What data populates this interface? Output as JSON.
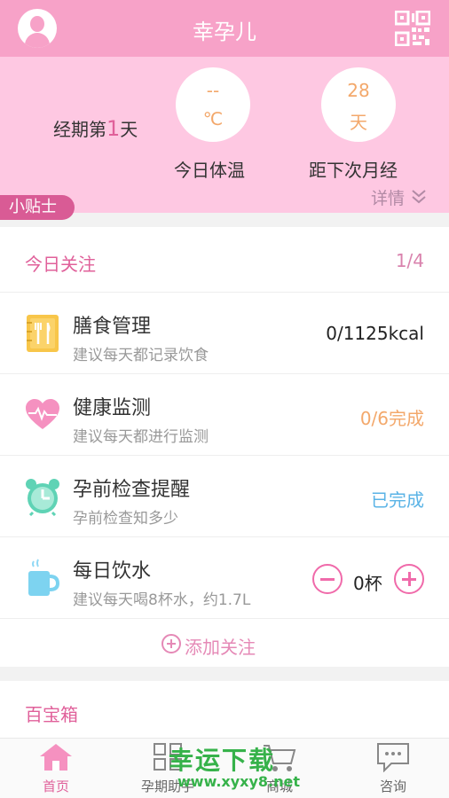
{
  "header": {
    "title": "幸孕儿"
  },
  "status": {
    "period_prefix": "经期第",
    "period_day": "1",
    "period_suffix": "天",
    "temperature": {
      "value": "--",
      "unit": "℃",
      "caption": "今日体温"
    },
    "next_period": {
      "value": "28",
      "unit": "天",
      "caption": "距下次月经"
    },
    "details_label": "详情",
    "tip_label": "小贴士"
  },
  "today": {
    "title": "今日关注",
    "count": "1/4",
    "items": [
      {
        "title": "膳食管理",
        "subtitle": "建议每天都记录饮食",
        "value": "0/1125kcal"
      },
      {
        "title": "健康监测",
        "subtitle": "建议每天都进行监测",
        "value": "0/6完成"
      },
      {
        "title": "孕前检查提醒",
        "subtitle": "孕前检查知多少",
        "value": "已完成"
      },
      {
        "title": "每日饮水",
        "subtitle": "建议每天喝8杯水，约1.7L",
        "value": "0杯"
      }
    ],
    "add_label": "添加关注"
  },
  "treasure": {
    "title": "百宝箱"
  },
  "nav": {
    "items": [
      {
        "label": "首页",
        "icon": "home-icon"
      },
      {
        "label": "孕期助手",
        "icon": "grid-icon"
      },
      {
        "label": "商城",
        "icon": "cart-icon"
      },
      {
        "label": "咨询",
        "icon": "chat-icon"
      }
    ]
  },
  "watermark": {
    "title": "幸运下载",
    "url": "www.xyxy8.net"
  },
  "colors": {
    "header": "#f7a2c8",
    "panel": "#fec8e2",
    "accent": "#e0609a",
    "orange": "#f3a86b",
    "blue": "#5ab3e6"
  }
}
